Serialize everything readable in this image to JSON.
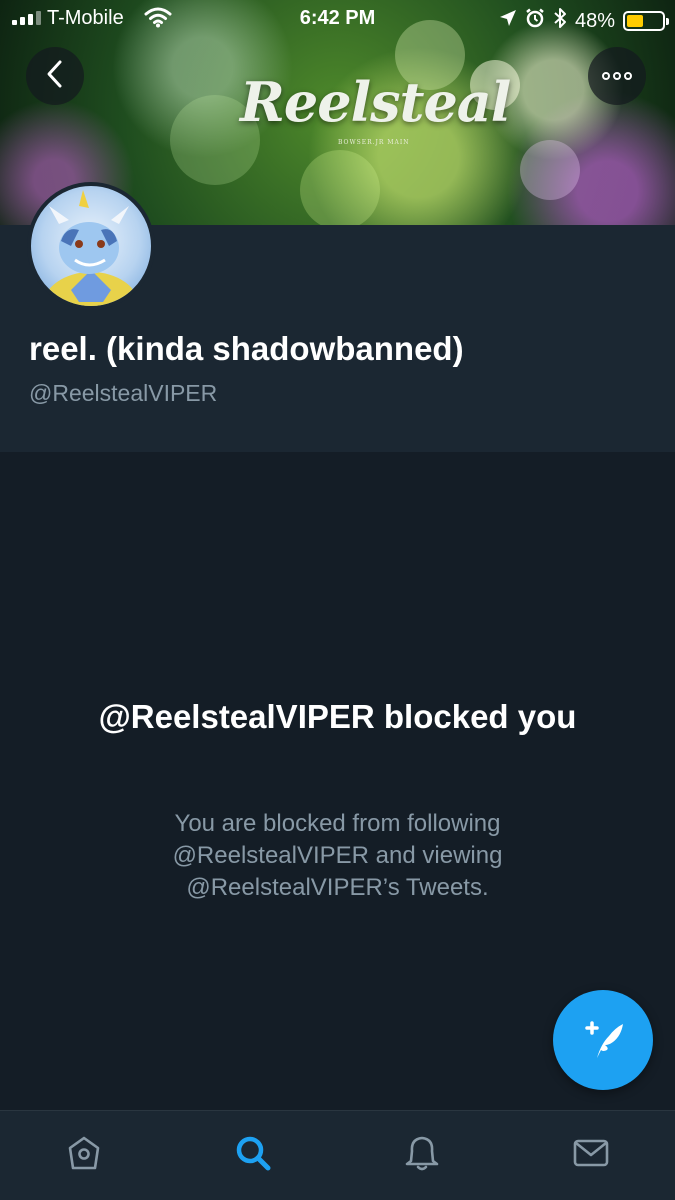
{
  "status_bar": {
    "carrier": "T-Mobile",
    "time": "6:42 PM",
    "battery_percent": "48%",
    "battery_level": 0.48,
    "battery_color": "#ffcc00",
    "icons": [
      "signal-icon",
      "wifi-icon",
      "location-icon",
      "alarm-icon",
      "bluetooth-icon",
      "battery-icon"
    ]
  },
  "banner": {
    "title": "Reelsteal",
    "subtitle": "BOWSER.JR MAIN"
  },
  "navigation": {
    "back_icon": "chevron-left-icon",
    "more_icon": "more-options-icon"
  },
  "profile": {
    "display_name": "reel. (kinda shadowbanned)",
    "handle": "@ReelstealVIPER"
  },
  "blocked": {
    "title": "@ReelstealVIPER blocked you",
    "description": "You are blocked from following @ReelstealVIPER and viewing @ReelstealVIPER’s Tweets."
  },
  "fab": {
    "icon": "compose-tweet-icon"
  },
  "tab_bar": {
    "active": "search",
    "accent_color": "#1da1f2",
    "items": [
      {
        "id": "home",
        "icon": "home-icon"
      },
      {
        "id": "search",
        "icon": "search-icon"
      },
      {
        "id": "notifications",
        "icon": "bell-icon"
      },
      {
        "id": "messages",
        "icon": "envelope-icon"
      }
    ]
  },
  "colors": {
    "background": "#141d26",
    "header_background": "#1b2732",
    "secondary_text": "#8899a6",
    "accent": "#1da1f2"
  }
}
